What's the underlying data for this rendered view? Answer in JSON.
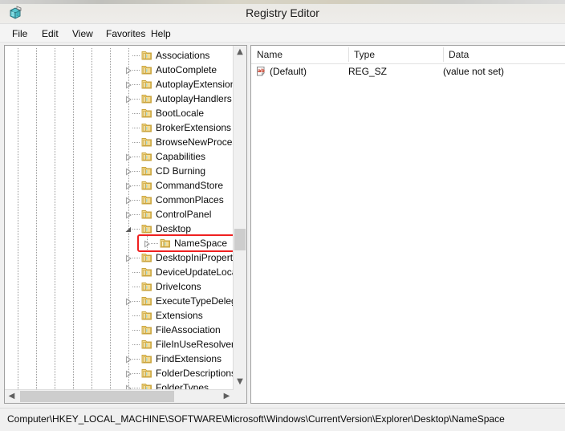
{
  "window": {
    "title": "Registry Editor",
    "icon": "registry-editor-icon"
  },
  "menu": [
    {
      "label": "File"
    },
    {
      "label": "Edit"
    },
    {
      "label": "View"
    },
    {
      "label": "Favorites"
    },
    {
      "label": "Help"
    }
  ],
  "tree": {
    "items": [
      {
        "label": "Associations",
        "expandable": false,
        "expanded": false,
        "selected": false
      },
      {
        "label": "AutoComplete",
        "expandable": true,
        "expanded": false,
        "selected": false
      },
      {
        "label": "AutoplayExtensions",
        "expandable": true,
        "expanded": false,
        "selected": false
      },
      {
        "label": "AutoplayHandlers",
        "expandable": true,
        "expanded": false,
        "selected": false
      },
      {
        "label": "BootLocale",
        "expandable": false,
        "expanded": false,
        "selected": false
      },
      {
        "label": "BrokerExtensions",
        "expandable": false,
        "expanded": false,
        "selected": false
      },
      {
        "label": "BrowseNewProcess",
        "expandable": false,
        "expanded": false,
        "selected": false
      },
      {
        "label": "Capabilities",
        "expandable": true,
        "expanded": false,
        "selected": false
      },
      {
        "label": "CD Burning",
        "expandable": true,
        "expanded": false,
        "selected": false
      },
      {
        "label": "CommandStore",
        "expandable": true,
        "expanded": false,
        "selected": false
      },
      {
        "label": "CommonPlaces",
        "expandable": true,
        "expanded": false,
        "selected": false
      },
      {
        "label": "ControlPanel",
        "expandable": true,
        "expanded": false,
        "selected": false
      },
      {
        "label": "Desktop",
        "expandable": true,
        "expanded": true,
        "selected": false
      },
      {
        "label": "NameSpace",
        "expandable": true,
        "expanded": false,
        "selected": true
      },
      {
        "label": "DesktopIniProperty",
        "expandable": true,
        "expanded": false,
        "selected": false
      },
      {
        "label": "DeviceUpdateLocat",
        "expandable": false,
        "expanded": false,
        "selected": false
      },
      {
        "label": "DriveIcons",
        "expandable": false,
        "expanded": false,
        "selected": false
      },
      {
        "label": "ExecuteTypeDelega",
        "expandable": true,
        "expanded": false,
        "selected": false
      },
      {
        "label": "Extensions",
        "expandable": false,
        "expanded": false,
        "selected": false
      },
      {
        "label": "FileAssociation",
        "expandable": false,
        "expanded": false,
        "selected": false
      },
      {
        "label": "FileInUseResolver",
        "expandable": false,
        "expanded": false,
        "selected": false
      },
      {
        "label": "FindExtensions",
        "expandable": true,
        "expanded": false,
        "selected": false
      },
      {
        "label": "FolderDescriptions",
        "expandable": true,
        "expanded": false,
        "selected": false
      },
      {
        "label": "FolderTypes",
        "expandable": true,
        "expanded": false,
        "selected": false
      }
    ]
  },
  "values": {
    "columns": [
      "Name",
      "Type",
      "Data"
    ],
    "rows": [
      {
        "name": "(Default)",
        "type": "REG_SZ",
        "data": "(value not set)",
        "icon": "string-value-icon"
      }
    ]
  },
  "status": {
    "path": "Computer\\HKEY_LOCAL_MACHINE\\SOFTWARE\\Microsoft\\Windows\\CurrentVersion\\Explorer\\Desktop\\NameSpace"
  },
  "annotation": {
    "color": "#ef2020",
    "target": "NameSpace"
  }
}
